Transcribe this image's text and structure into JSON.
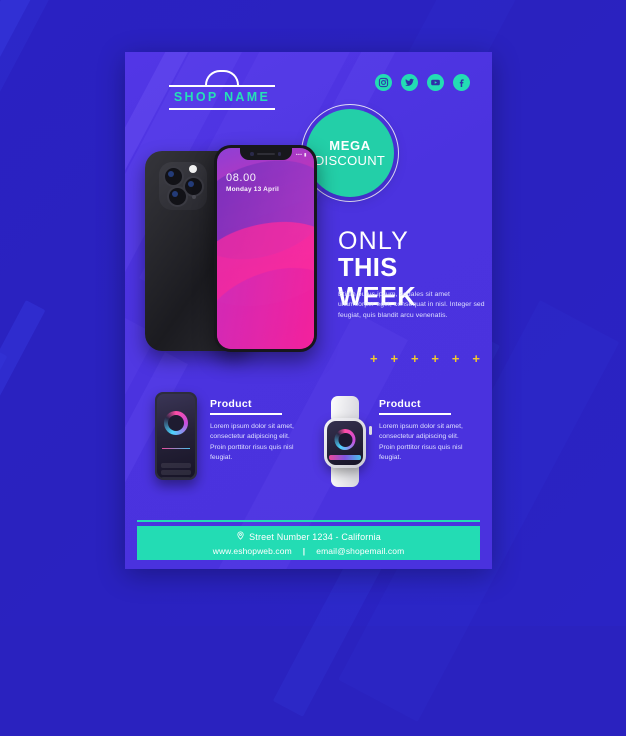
{
  "poster": {
    "brand": {
      "logo_icon": "shopping-bag-icon",
      "name": "SHOP NAME"
    },
    "social": [
      {
        "icon": "instagram-icon",
        "name": "Instagram"
      },
      {
        "icon": "twitter-icon",
        "name": "Twitter"
      },
      {
        "icon": "youtube-icon",
        "name": "YouTube"
      },
      {
        "icon": "facebook-icon",
        "name": "Facebook"
      }
    ],
    "badge": {
      "line1": "MEGA",
      "line2": "DISCOUNT"
    },
    "phone_mockup": {
      "time": "08.00",
      "date": "Monday 13 April",
      "status": "•••  ▮"
    },
    "headline": {
      "line1": "ONLY",
      "line2": "THIS WEEK"
    },
    "paragraph": "Etiam purus ipsum, sodales sit amet ullamcorper eget, consequat in nisl. Integer sed feugiat, quis blandit arcu venenatis.",
    "plus_row": [
      "+",
      "+",
      "+",
      "+",
      "+",
      "+"
    ],
    "products": [
      {
        "image": "smartphone-fitness-app-image",
        "title": "Product",
        "body": "Lorem ipsum dolor sit amet, consectetur adipiscing elit. Proin porttitor risus quis nisl feugiat."
      },
      {
        "image": "smartwatch-image",
        "title": "Product",
        "body": "Lorem ipsum dolor sit amet, consectetur adipiscing elit. Proin porttitor risus quis nisl feugiat."
      }
    ],
    "footer": {
      "location_icon": "map-pin-icon",
      "address": "Street Number 1234 - California",
      "website": "www.eshopweb.com",
      "separator": "|",
      "email": "email@shopemail.com"
    }
  },
  "colors": {
    "background_blue": "#2a22bf",
    "poster_purple": "#4b33df",
    "stripe_blue": "#6f56f5",
    "accent_teal": "#23dcb4",
    "badge_teal": "#23cfa8",
    "plus_yellow": "#f2c82e",
    "text_white": "#ffffff",
    "body_text": "#dfe0ff",
    "screen_pink": "#ff1f96"
  }
}
